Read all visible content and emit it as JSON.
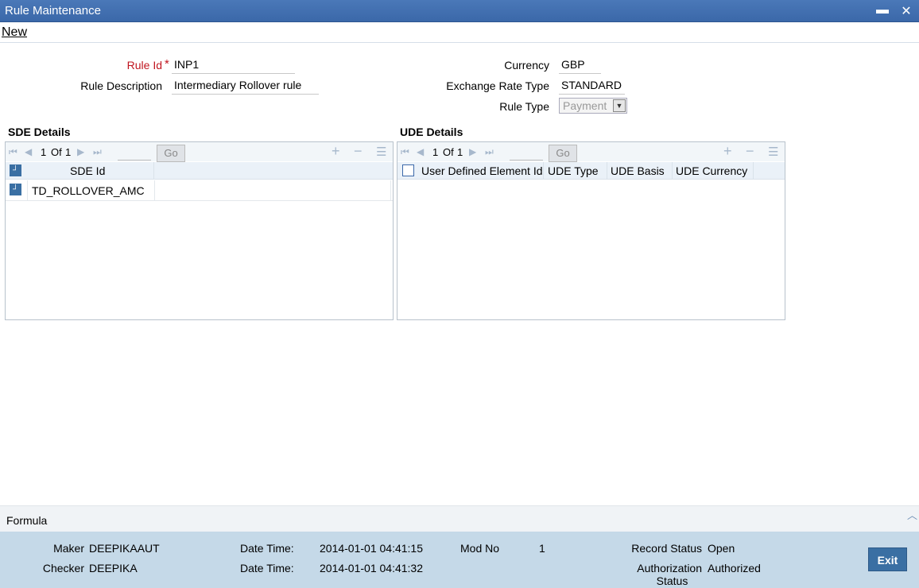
{
  "window": {
    "title": "Rule Maintenance",
    "minimize": "▬",
    "close": "✕"
  },
  "menu": {
    "new": "New"
  },
  "form": {
    "rule_id_label": "Rule Id",
    "required_mark": "*",
    "rule_id_value": "INP1",
    "rule_desc_label": "Rule Description",
    "rule_desc_value": "Intermediary Rollover rule",
    "currency_label": "Currency",
    "currency_value": "GBP",
    "exch_label": "Exchange Rate Type",
    "exch_value": "STANDARD",
    "rule_type_label": "Rule Type",
    "rule_type_value": "Payment"
  },
  "sde": {
    "title": "SDE Details",
    "page_current": "1",
    "page_of": "Of",
    "page_total": "1",
    "go": "Go",
    "col_sde_id": "SDE Id",
    "rows": [
      {
        "sde_id": "TD_ROLLOVER_AMC"
      }
    ]
  },
  "ude": {
    "title": "UDE Details",
    "page_current": "1",
    "page_of": "Of",
    "page_total": "1",
    "go": "Go",
    "columns": [
      "User Defined Element Id",
      "UDE Type",
      "UDE Basis",
      "UDE Currency"
    ]
  },
  "formula": {
    "label": "Formula"
  },
  "audit": {
    "maker_label": "Maker",
    "maker_value": "DEEPIKAAUT",
    "checker_label": "Checker",
    "checker_value": "DEEPIKA",
    "dt1_label": "Date Time:",
    "dt1_value": "2014-01-01 04:41:15",
    "dt2_label": "Date Time:",
    "dt2_value": "2014-01-01 04:41:32",
    "mod_label": "Mod No",
    "mod_value": "1",
    "record_status_label": "Record Status",
    "record_status_value": "Open",
    "auth_label_1": "Authorization",
    "auth_label_2": "Status",
    "auth_value": "Authorized"
  },
  "buttons": {
    "exit": "Exit"
  }
}
